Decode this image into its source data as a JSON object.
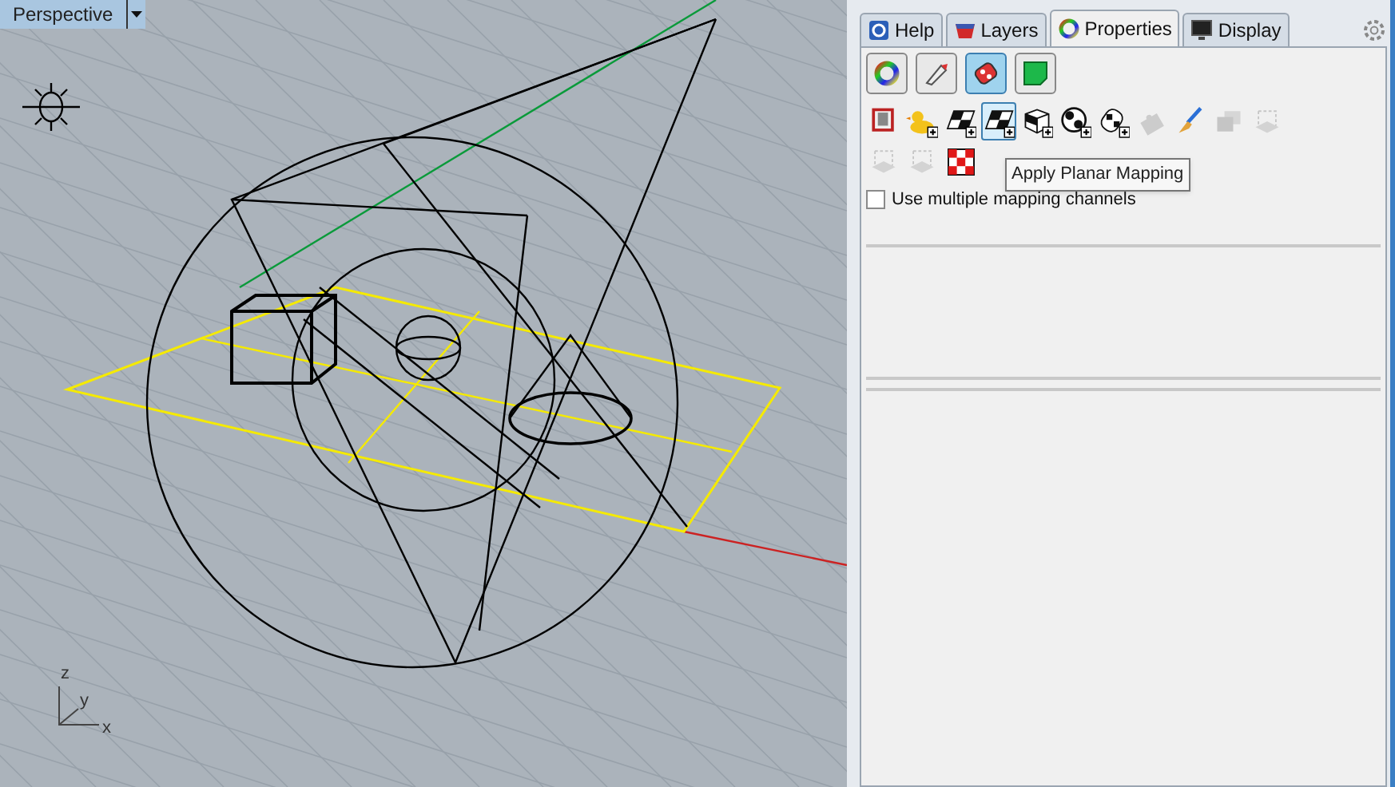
{
  "viewport": {
    "title": "Perspective",
    "axis_labels": [
      "z",
      "y",
      "x"
    ]
  },
  "panel": {
    "tabs": [
      {
        "label": "Help",
        "selected": false
      },
      {
        "label": "Layers",
        "selected": false
      },
      {
        "label": "Properties",
        "selected": true
      },
      {
        "label": "Display",
        "selected": false
      }
    ],
    "section_buttons": [
      {
        "selected": false
      },
      {
        "selected": false
      },
      {
        "selected": true
      },
      {
        "selected": false
      }
    ],
    "mapping_tools": [
      {
        "selected": false,
        "disabled": false
      },
      {
        "selected": false,
        "disabled": false
      },
      {
        "selected": false,
        "disabled": false
      },
      {
        "selected": true,
        "disabled": false
      },
      {
        "selected": false,
        "disabled": false
      },
      {
        "selected": false,
        "disabled": false
      },
      {
        "selected": false,
        "disabled": false
      },
      {
        "selected": false,
        "disabled": true
      },
      {
        "selected": false,
        "disabled": false
      },
      {
        "selected": false,
        "disabled": true
      },
      {
        "selected": false,
        "disabled": true
      },
      {
        "selected": false,
        "disabled": true
      },
      {
        "selected": false,
        "disabled": true
      },
      {
        "selected": false,
        "disabled": false
      }
    ],
    "tooltip": "Apply Planar Mapping",
    "option": {
      "label": "Use multiple mapping channels",
      "checked": false
    }
  }
}
